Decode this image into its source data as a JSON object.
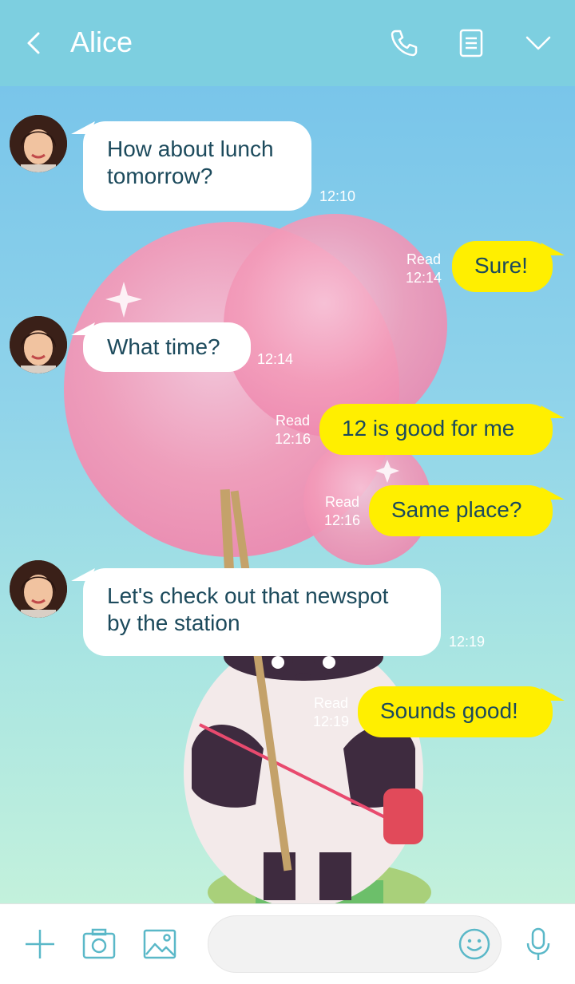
{
  "header": {
    "title": "Alice",
    "icons": [
      "back-chevron-icon",
      "phone-icon",
      "notes-icon",
      "chevron-down-icon"
    ]
  },
  "messages": [
    {
      "direction": "in",
      "text_lines": [
        "How about lunch",
        "tomorrow?"
      ],
      "time": "12:10"
    },
    {
      "direction": "out",
      "text_lines": [
        "Sure!"
      ],
      "status": "Read",
      "time": "12:14"
    },
    {
      "direction": "in",
      "text_lines": [
        "What time?"
      ],
      "time": "12:14"
    },
    {
      "direction": "out",
      "text_lines": [
        "12 is good for me"
      ],
      "status": "Read",
      "time": "12:16"
    },
    {
      "direction": "out",
      "text_lines": [
        "Same place?"
      ],
      "status": "Read",
      "time": "12:16"
    },
    {
      "direction": "in",
      "text_lines": [
        "Let's check out that newspot",
        "by the station"
      ],
      "time": "12:19"
    },
    {
      "direction": "out",
      "text_lines": [
        "Sounds good!"
      ],
      "status": "Read",
      "time": "12:19"
    }
  ],
  "footer": {
    "icons": [
      "plus-icon",
      "camera-icon",
      "image-icon",
      "emoji-icon",
      "microphone-icon"
    ],
    "input_placeholder": ""
  },
  "colors": {
    "header": "#7dcfe0",
    "incoming_bubble": "#ffffff",
    "outgoing_bubble": "#ffef00",
    "bubble_text": "#1c4a5c",
    "icon_accent": "#5ab8c8"
  }
}
